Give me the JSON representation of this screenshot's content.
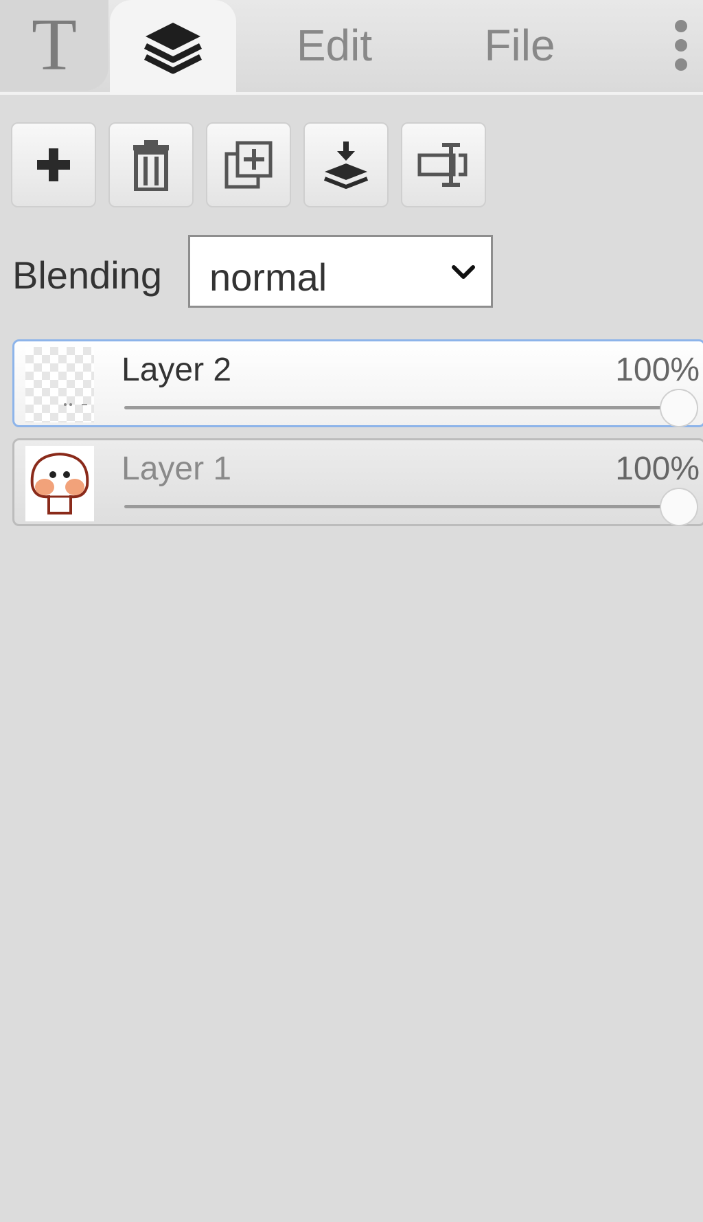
{
  "tabs": {
    "text_glyph": "T",
    "layers_icon": "layers-icon",
    "edit_label": "Edit",
    "file_label": "File",
    "more_icon": "more-vertical-icon"
  },
  "toolbar": {
    "buttons": [
      {
        "icon": "plus-icon"
      },
      {
        "icon": "trash-icon"
      },
      {
        "icon": "duplicate-icon"
      },
      {
        "icon": "merge-down-icon"
      },
      {
        "icon": "rename-icon"
      }
    ]
  },
  "blending": {
    "label": "Blending",
    "value": "normal"
  },
  "layers": [
    {
      "name": "Layer 2",
      "opacity_label": "100%",
      "opacity": 1.0,
      "selected": true,
      "thumbnail": "transparent"
    },
    {
      "name": "Layer 1",
      "opacity_label": "100%",
      "opacity": 1.0,
      "selected": false,
      "thumbnail": "mushroom-drawing"
    }
  ],
  "colors": {
    "selected_border": "#8db4ea",
    "panel_background": "#dcdcdc"
  }
}
